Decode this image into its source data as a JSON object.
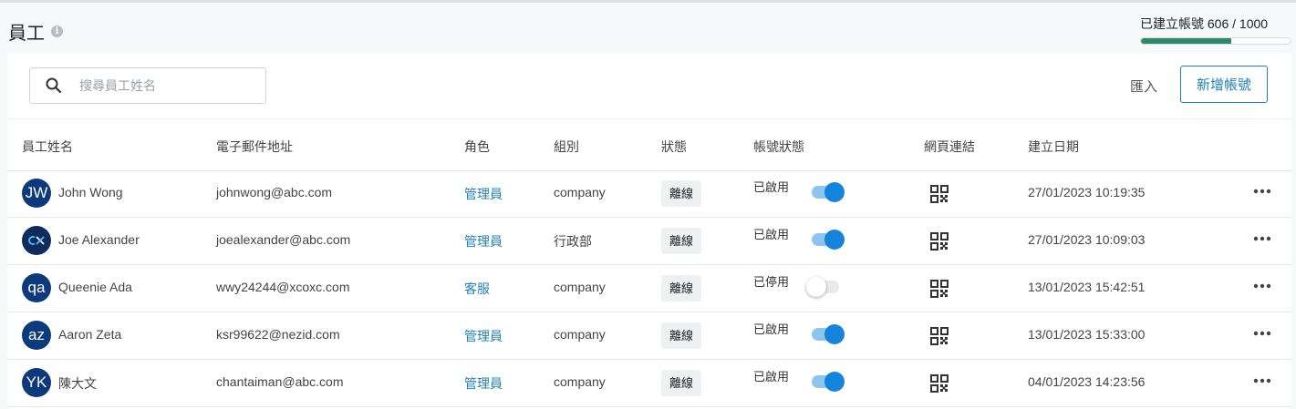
{
  "page": {
    "title": "員工"
  },
  "quota": {
    "label": "已建立帳號 606 / 1000",
    "used": 606,
    "total": 1000,
    "fill_color": "#2d8a67"
  },
  "search": {
    "placeholder": "搜尋員工姓名",
    "value": ""
  },
  "toolbar": {
    "import_label": "匯入",
    "add_label": "新增帳號"
  },
  "table": {
    "headers": {
      "name": "員工姓名",
      "email": "電子郵件地址",
      "role": "角色",
      "group": "組別",
      "status": "狀態",
      "account_status": "帳號狀態",
      "web_link": "網頁連結",
      "created": "建立日期"
    },
    "rows": [
      {
        "avatar": "JW",
        "name": "John Wong",
        "email": "johnwong@abc.com",
        "role": "管理員",
        "group": "company",
        "status": "離線",
        "account_status": "已啟用",
        "enabled": true,
        "created": "27/01/2023 10:19:35"
      },
      {
        "avatar": "cx-logo-icon",
        "name": "Joe Alexander",
        "email": "joealexander@abc.com",
        "role": "管理員",
        "group": "行政部",
        "status": "離線",
        "account_status": "已啟用",
        "enabled": true,
        "created": "27/01/2023 10:09:03"
      },
      {
        "avatar": "qa",
        "name": "Queenie Ada",
        "email": "wwy24244@xcoxc.com",
        "role": "客服",
        "group": "company",
        "status": "離線",
        "account_status": "已停用",
        "enabled": false,
        "created": "13/01/2023 15:42:51"
      },
      {
        "avatar": "az",
        "name": "Aaron Zeta",
        "email": "ksr99622@nezid.com",
        "role": "管理員",
        "group": "company",
        "status": "離線",
        "account_status": "已啟用",
        "enabled": true,
        "created": "13/01/2023 15:33:00"
      },
      {
        "avatar": "YK",
        "name": "陳大文",
        "email": "chantaiman@abc.com",
        "role": "管理員",
        "group": "company",
        "status": "離線",
        "account_status": "已啟用",
        "enabled": true,
        "created": "04/01/2023 14:23:56"
      }
    ]
  },
  "colors": {
    "accent": "#1f7fb7",
    "avatar_bg": "#0d3a7c",
    "toggle_on": "#1784dc"
  }
}
